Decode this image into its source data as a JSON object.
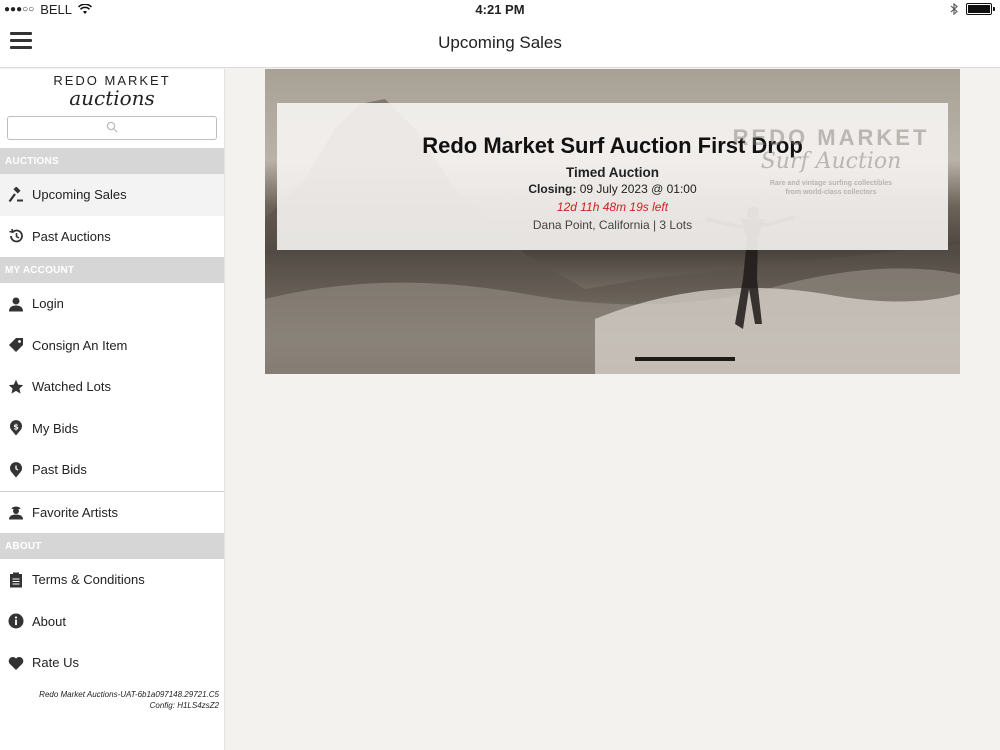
{
  "status_bar": {
    "carrier": "BELL",
    "time": "4:21 PM"
  },
  "nav": {
    "title": "Upcoming Sales"
  },
  "sidebar": {
    "logo_line1": "REDO MARKET",
    "logo_line2": "auctions",
    "search_placeholder": "",
    "sections": {
      "auctions": "AUCTIONS",
      "account": "MY ACCOUNT",
      "about": "ABOUT"
    },
    "items": {
      "upcoming": "Upcoming Sales",
      "past_auctions": "Past Auctions",
      "login": "Login",
      "consign": "Consign An Item",
      "watched": "Watched Lots",
      "my_bids": "My Bids",
      "past_bids": "Past Bids",
      "favorite_artists": "Favorite Artists",
      "terms": "Terms & Conditions",
      "about": "About",
      "rate": "Rate Us"
    },
    "version_line1": "Redo Market Auctions-UAT-6b1a097148.29721.C5",
    "version_line2": "Config: H1LS4zsZ2"
  },
  "auction": {
    "title": "Redo Market Surf Auction First Drop",
    "type": "Timed Auction",
    "closing_label": "Closing:",
    "closing_value": "09 July 2023 @ 01:00",
    "time_left": "12d 11h 48m 19s left",
    "location_lots": "Dana Point, California | 3 Lots",
    "watermark_line1": "REDO MARKET",
    "watermark_line2": "Surf Auction",
    "watermark_line3": "Rare and vintage surfing collectibles",
    "watermark_line4": "from world-class collectors"
  },
  "colors": {
    "accent": "#cc2222",
    "section_bg": "#d6d6d6",
    "background": "#f4f2ef"
  }
}
